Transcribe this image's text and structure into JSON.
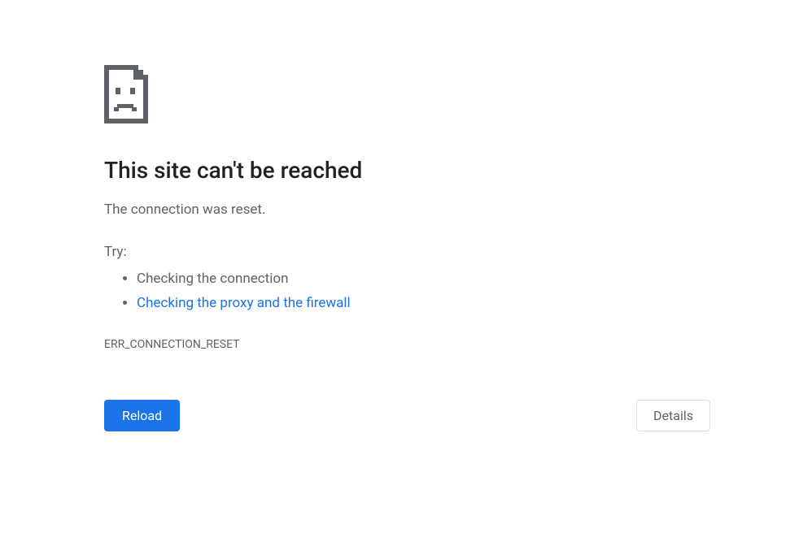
{
  "error": {
    "title": "This site can't be reached",
    "message": "The connection was reset.",
    "try_label": "Try:",
    "suggestions": {
      "check_connection": "Checking the connection",
      "check_proxy_firewall": "Checking the proxy and the firewall"
    },
    "error_code": "ERR_CONNECTION_RESET"
  },
  "buttons": {
    "reload": "Reload",
    "details": "Details"
  }
}
